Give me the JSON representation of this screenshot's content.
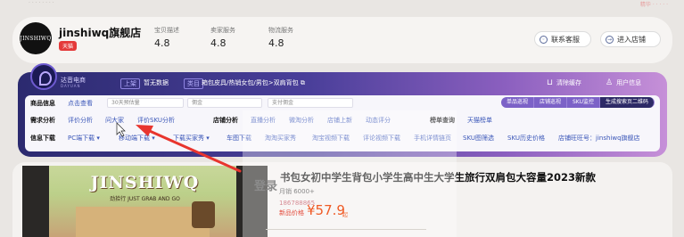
{
  "topstrip": {
    "left": "· · · · · · · ·",
    "right": "精华 · · · · ·"
  },
  "shop": {
    "logo": "JINSHIWQ",
    "name": "jinshiwq旗舰店",
    "badge": "天猫",
    "metrics": [
      {
        "label": "宝贝描述",
        "value": "4.8"
      },
      {
        "label": "卖家服务",
        "value": "4.8"
      },
      {
        "label": "物流服务",
        "value": "4.8"
      }
    ],
    "buttons": [
      {
        "label": "联系客服",
        "icon": "chat-icon"
      },
      {
        "label": "进入店铺",
        "icon": "enter-icon"
      }
    ]
  },
  "plugin": {
    "brand": "达音电商",
    "brand_sub": "DAYUAN",
    "tag_up": "上架",
    "up_value": "暂无数据",
    "tag_cur": "类目",
    "cur_value": "箱包皮具/热销女包/男包>双肩背包",
    "cur_icon": "copy-icon",
    "header_links": [
      {
        "label": "清除缓存",
        "icon": "cart-icon"
      },
      {
        "label": "用户信息",
        "icon": "user-icon"
      }
    ],
    "row1": {
      "lead": "商品信息",
      "link": "点击查看",
      "input1": "30天预估量",
      "input2": "佣金",
      "input3": "支付佣金",
      "segments": [
        "单品巡视",
        "店铺巡视",
        "SKU监控",
        "生成搜索页二维码"
      ]
    },
    "row2": {
      "lead": "需求分析",
      "items": [
        "评价分析",
        "问大家",
        "评价SKU分析"
      ],
      "lead2": "店铺分析",
      "items2": [
        "直播分析",
        "微淘分析",
        "店铺上新",
        "动态评分"
      ],
      "lead3": "榜单查询",
      "items3": [
        "天猫榜单"
      ]
    },
    "row3": {
      "lead": "信息下载",
      "items": [
        "PC端下载 ▾",
        "移动端下载 ▾",
        "下载买家秀 ▾",
        "车图下载",
        "淘淘买家秀",
        "淘宝视频下载",
        "评论视频下载",
        "手机详情链页",
        "SKU图筛选",
        "SKU历史价格",
        "店铺旺旺号：jinshiwq旗舰店"
      ]
    }
  },
  "product": {
    "image_brand": "JINSHIWQ",
    "image_slogan": "劲拾行 JUST GRAB AND GO",
    "title": "书包女初中学生背包小学生高中生大学生旅行双肩包大容量2023新款",
    "login_overlay": "登录",
    "sales": "月销 6000+",
    "phone": "186788865",
    "price_label": "新品价格",
    "price": "¥57.9",
    "unit": "起"
  }
}
